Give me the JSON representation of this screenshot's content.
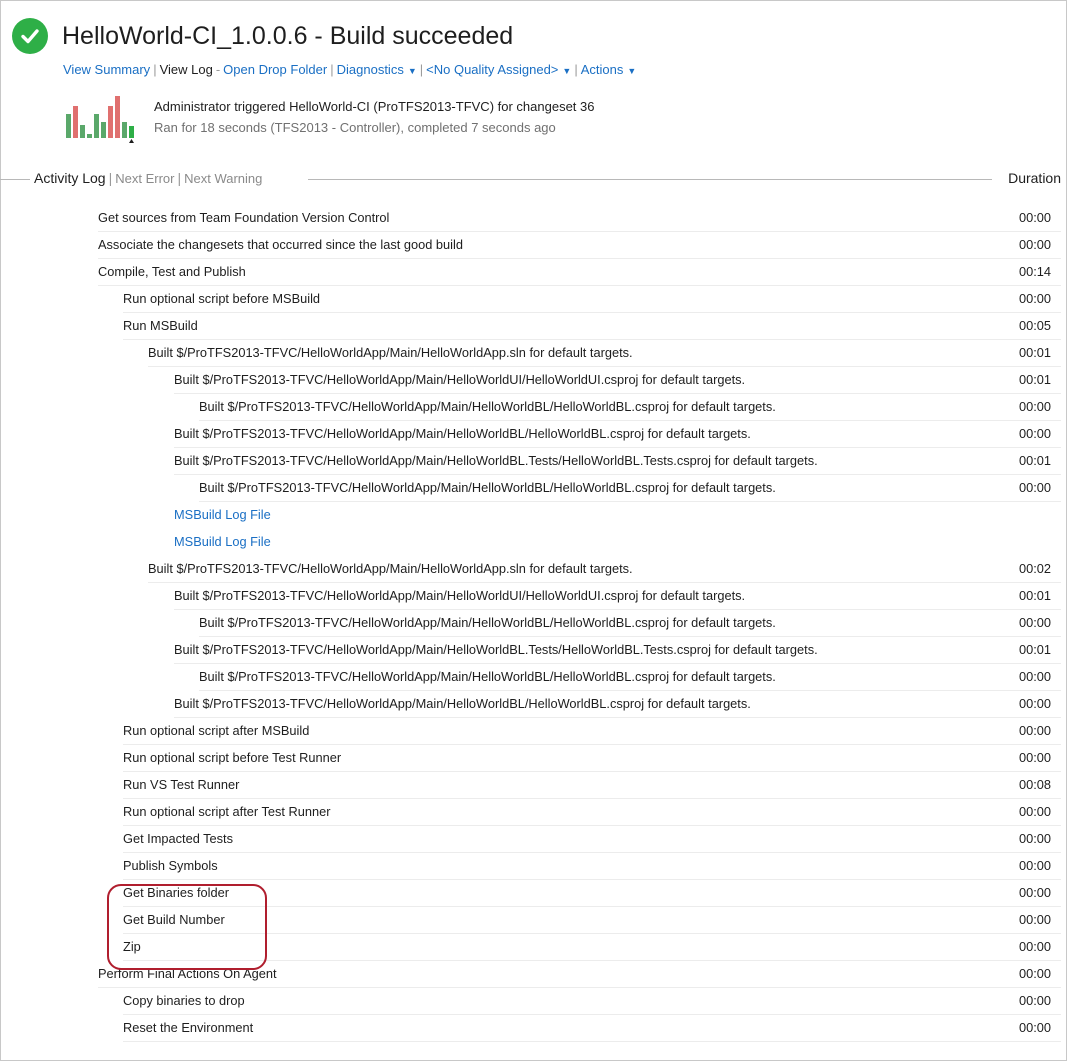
{
  "header": {
    "title": "HelloWorld-CI_1.0.0.6 - Build succeeded",
    "status_icon": "check-circle-icon",
    "status_color": "#2eaf47"
  },
  "links": {
    "view_summary": "View Summary",
    "view_log": "View Log",
    "open_drop_folder": "Open Drop Folder",
    "diagnostics": "Diagnostics",
    "quality": "<No Quality Assigned>",
    "actions": "Actions"
  },
  "summary": {
    "line1": "Administrator triggered HelloWorld-CI (ProTFS2013-TFVC) for changeset 36",
    "line2": "Ran for 18 seconds (TFS2013 - Controller), completed 7 seconds ago"
  },
  "activity_header": {
    "title": "Activity Log",
    "next_error": "Next Error",
    "next_warning": "Next Warning",
    "duration": "Duration"
  },
  "rows": [
    {
      "label": "Get sources from Team Foundation Version Control",
      "duration": "00:00",
      "level": 0,
      "link": false
    },
    {
      "label": "Associate the changesets that occurred since the last good build",
      "duration": "00:00",
      "level": 0,
      "link": false
    },
    {
      "label": "Compile, Test and Publish",
      "duration": "00:14",
      "level": 0,
      "link": false
    },
    {
      "label": "Run optional script before MSBuild",
      "duration": "00:00",
      "level": 1,
      "link": false
    },
    {
      "label": "Run MSBuild",
      "duration": "00:05",
      "level": 1,
      "link": false
    },
    {
      "label": "Built $/ProTFS2013-TFVC/HelloWorldApp/Main/HelloWorldApp.sln for default targets.",
      "duration": "00:01",
      "level": 2,
      "link": false
    },
    {
      "label": "Built $/ProTFS2013-TFVC/HelloWorldApp/Main/HelloWorldUI/HelloWorldUI.csproj for default targets.",
      "duration": "00:01",
      "level": 3,
      "link": false
    },
    {
      "label": "Built $/ProTFS2013-TFVC/HelloWorldApp/Main/HelloWorldBL/HelloWorldBL.csproj for default targets.",
      "duration": "00:00",
      "level": 4,
      "link": false
    },
    {
      "label": "Built $/ProTFS2013-TFVC/HelloWorldApp/Main/HelloWorldBL/HelloWorldBL.csproj for default targets.",
      "duration": "00:00",
      "level": 3,
      "link": false
    },
    {
      "label": "Built $/ProTFS2013-TFVC/HelloWorldApp/Main/HelloWorldBL.Tests/HelloWorldBL.Tests.csproj for default targets.",
      "duration": "00:01",
      "level": 3,
      "link": false
    },
    {
      "label": "Built $/ProTFS2013-TFVC/HelloWorldApp/Main/HelloWorldBL/HelloWorldBL.csproj for default targets.",
      "duration": "00:00",
      "level": 4,
      "link": false
    },
    {
      "label": "MSBuild Log File",
      "duration": "",
      "level": 3,
      "link": true
    },
    {
      "label": "MSBuild Log File",
      "duration": "",
      "level": 3,
      "link": true
    },
    {
      "label": "Built $/ProTFS2013-TFVC/HelloWorldApp/Main/HelloWorldApp.sln for default targets.",
      "duration": "00:02",
      "level": 2,
      "link": false
    },
    {
      "label": "Built $/ProTFS2013-TFVC/HelloWorldApp/Main/HelloWorldUI/HelloWorldUI.csproj for default targets.",
      "duration": "00:01",
      "level": 3,
      "link": false
    },
    {
      "label": "Built $/ProTFS2013-TFVC/HelloWorldApp/Main/HelloWorldBL/HelloWorldBL.csproj for default targets.",
      "duration": "00:00",
      "level": 4,
      "link": false
    },
    {
      "label": "Built $/ProTFS2013-TFVC/HelloWorldApp/Main/HelloWorldBL.Tests/HelloWorldBL.Tests.csproj for default targets.",
      "duration": "00:01",
      "level": 3,
      "link": false
    },
    {
      "label": "Built $/ProTFS2013-TFVC/HelloWorldApp/Main/HelloWorldBL/HelloWorldBL.csproj for default targets.",
      "duration": "00:00",
      "level": 4,
      "link": false
    },
    {
      "label": "Built $/ProTFS2013-TFVC/HelloWorldApp/Main/HelloWorldBL/HelloWorldBL.csproj for default targets.",
      "duration": "00:00",
      "level": 3,
      "link": false
    },
    {
      "label": "Run optional script after MSBuild",
      "duration": "00:00",
      "level": 1,
      "link": false
    },
    {
      "label": "Run optional script before Test Runner",
      "duration": "00:00",
      "level": 1,
      "link": false
    },
    {
      "label": "Run VS Test Runner",
      "duration": "00:08",
      "level": 1,
      "link": false
    },
    {
      "label": "Run optional script after Test Runner",
      "duration": "00:00",
      "level": 1,
      "link": false
    },
    {
      "label": "Get Impacted Tests",
      "duration": "00:00",
      "level": 1,
      "link": false
    },
    {
      "label": "Publish Symbols",
      "duration": "00:00",
      "level": 1,
      "link": false
    },
    {
      "label": "Get Binaries folder",
      "duration": "00:00",
      "level": 1,
      "link": false
    },
    {
      "label": "Get Build Number",
      "duration": "00:00",
      "level": 1,
      "link": false
    },
    {
      "label": "Zip",
      "duration": "00:00",
      "level": 1,
      "link": false
    },
    {
      "label": "Perform Final Actions On Agent",
      "duration": "00:00",
      "level": 0,
      "link": false
    },
    {
      "label": "Copy binaries to drop",
      "duration": "00:00",
      "level": 1,
      "link": false
    },
    {
      "label": "Reset the Environment",
      "duration": "00:00",
      "level": 1,
      "link": false
    }
  ],
  "colors": {
    "link": "#1a6fc4",
    "success": "#2eaf47",
    "highlight": "#b01e2e",
    "bar_green": "#5aa86a",
    "bar_red": "#e0706f"
  }
}
